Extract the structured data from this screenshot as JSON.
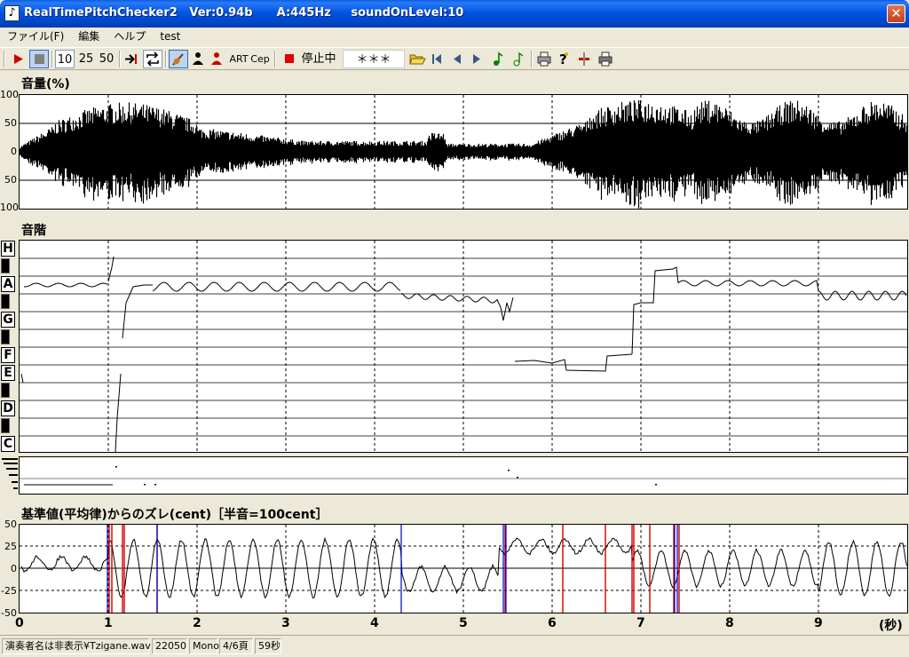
{
  "window": {
    "title": "RealTimePitchChecker2   Ver:0.94b      A:445Hz     soundOnLevel:10",
    "close": "✕"
  },
  "menu": [
    "ファイル(F)",
    "編集",
    "ヘルプ",
    "test"
  ],
  "toolbar": {
    "num10": "10",
    "num25": "25",
    "num50": "50",
    "art": "ART",
    "cep": "Cep",
    "status": "停止中",
    "stars": "＊＊＊"
  },
  "volume_panel": {
    "title": "音量(%)",
    "y_labels": [
      "100",
      "50",
      "0",
      "50",
      "100"
    ]
  },
  "pitch_panel": {
    "title": "音階",
    "notes": [
      "H",
      "A",
      "G",
      "F",
      "E",
      "D",
      "C"
    ]
  },
  "cent_panel": {
    "title": "基準値(平均律)からのズレ(cent)［半音=100cent］",
    "y_labels": [
      "50",
      "25",
      "0",
      "-25",
      "-50"
    ]
  },
  "x_axis": {
    "labels": [
      "0",
      "1",
      "2",
      "3",
      "4",
      "5",
      "6",
      "7",
      "8",
      "9"
    ],
    "unit": "(秒)"
  },
  "statusbar": {
    "file": "演奏者名は非表示¥Tzigane.wav",
    "rate": "22050",
    "channels": "Mono",
    "page": "4/6頁",
    "length": "59秒"
  },
  "colors": {
    "accent_red": "#d00000",
    "accent_blue": "#0000c0",
    "titlebar": "#0054e3"
  }
}
